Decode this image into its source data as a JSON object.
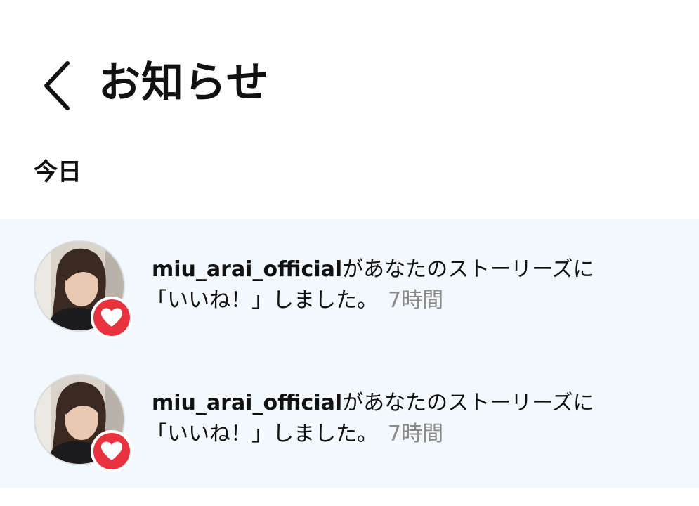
{
  "header": {
    "back_icon": "chevron-left-icon",
    "title": "お知らせ"
  },
  "sections": [
    {
      "heading": "今日",
      "notifications": [
        {
          "username": "miu_arai_official",
          "message_line1": "があなたのストーリーズに",
          "message_line2": "「いいね！」しました。",
          "time": "7時間",
          "badge_icon": "heart-icon",
          "badge_color": "#e8333f"
        },
        {
          "username": "miu_arai_official",
          "message_line1": "があなたのストーリーズに",
          "message_line2": "「いいね！」しました。",
          "time": "7時間",
          "badge_icon": "heart-icon",
          "badge_color": "#e8333f"
        }
      ]
    }
  ],
  "colors": {
    "unread_background": "#f3f8fd",
    "timestamp": "#8a8a8a",
    "text": "#111111"
  }
}
